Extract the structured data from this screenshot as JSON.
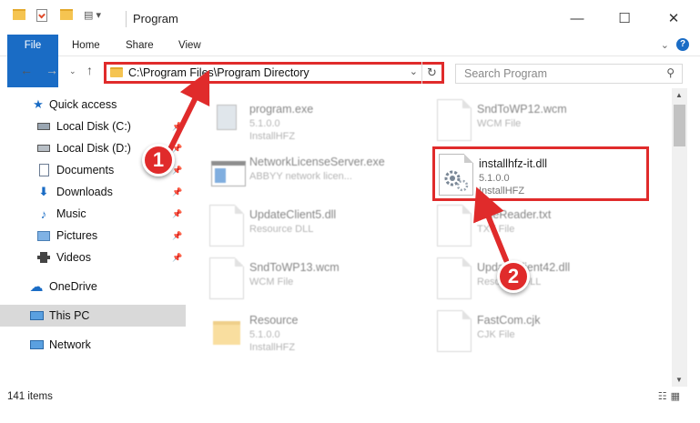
{
  "window": {
    "title": "Program"
  },
  "ribbon": {
    "tabs": [
      "File",
      "Home",
      "Share",
      "View"
    ]
  },
  "nav": {
    "address": "C:\\Program Files\\Program Directory",
    "search_placeholder": "Search Program"
  },
  "sidebar": {
    "items": [
      {
        "label": "Quick access",
        "icon": "star-icon",
        "pinned": false
      },
      {
        "label": "Local Disk (C:)",
        "icon": "drive-icon",
        "pinned": true
      },
      {
        "label": "Local Disk (D:)",
        "icon": "drive-icon",
        "pinned": true
      },
      {
        "label": "Documents",
        "icon": "documents-icon",
        "pinned": true
      },
      {
        "label": "Downloads",
        "icon": "download-icon",
        "pinned": true
      },
      {
        "label": "Music",
        "icon": "music-icon",
        "pinned": true
      },
      {
        "label": "Pictures",
        "icon": "pictures-icon",
        "pinned": true
      },
      {
        "label": "Videos",
        "icon": "videos-icon",
        "pinned": true
      },
      {
        "label": "OneDrive",
        "icon": "cloud-icon",
        "pinned": false
      },
      {
        "label": "This PC",
        "icon": "computer-icon",
        "pinned": false,
        "selected": true
      },
      {
        "label": "Network",
        "icon": "network-icon",
        "pinned": false
      }
    ]
  },
  "files": [
    {
      "name": "program.exe",
      "line1": "5.1.0.0",
      "line2": "InstallHFZ"
    },
    {
      "name": "SndToWP12.wcm",
      "line1": "WCM File",
      "line2": ""
    },
    {
      "name": "NetworkLicenseServer.exe",
      "line1": "ABBYY network licen...",
      "line2": ""
    },
    {
      "name": "installhfz-it.dll",
      "line1": "5.1.0.0",
      "line2": "InstallHFZ"
    },
    {
      "name": "UpdateClient5.dll",
      "line1": "Resource DLL",
      "line2": ""
    },
    {
      "name": "FineReader.txt",
      "line1": "TXT File",
      "line2": ""
    },
    {
      "name": "SndToWP13.wcm",
      "line1": "WCM File",
      "line2": ""
    },
    {
      "name": "UpdateClient42.dll",
      "line1": "Resource DLL",
      "line2": ""
    },
    {
      "name": "Resource",
      "line1": "5.1.0.0",
      "line2": "InstallHFZ"
    },
    {
      "name": "FastCom.cjk",
      "line1": "CJK File",
      "line2": ""
    }
  ],
  "status": {
    "items": "141 items"
  },
  "annotations": {
    "step1": "1",
    "step2": "2"
  },
  "colors": {
    "accent": "#1a6cc5",
    "highlight": "#e02b2b"
  }
}
